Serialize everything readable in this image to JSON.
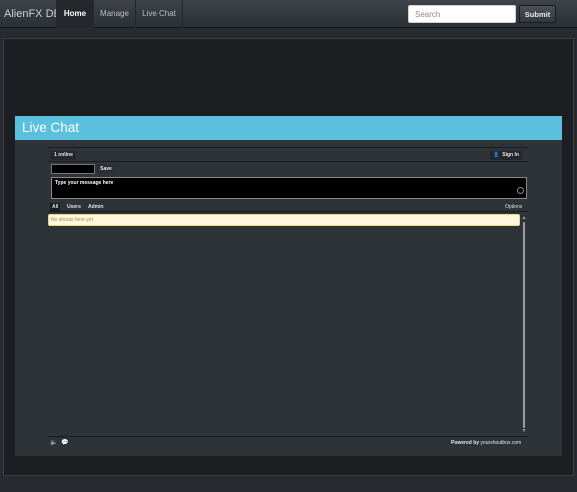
{
  "navbar": {
    "brand": "AlienFX DB",
    "items": [
      {
        "label": "Home",
        "active": true
      },
      {
        "label": "Manage",
        "active": false
      },
      {
        "label": "Live Chat",
        "active": false
      }
    ],
    "search_placeholder": "Search",
    "submit_label": "Submit"
  },
  "chat": {
    "title": "Live Chat",
    "online_label": "1 online",
    "sign_in_label": "Sign In",
    "save_label": "Save",
    "message_placeholder": "Type your message here",
    "tabs": [
      "All",
      "Users",
      "Admin"
    ],
    "options_label": "Options",
    "empty_message": "No shouts here yet",
    "powered_prefix": "Powered by",
    "powered_link": "yourshoutbox.com",
    "accent_color": "#5bc0de"
  }
}
